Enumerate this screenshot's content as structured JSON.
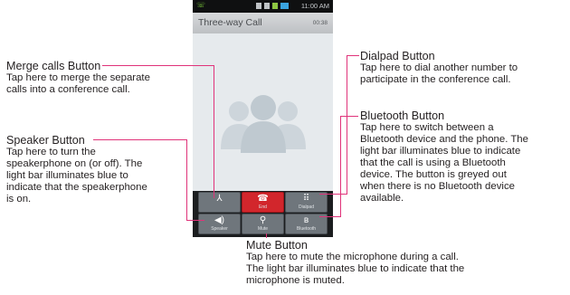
{
  "phone": {
    "status_time": "11:00 AM",
    "call_title": "Three-way Call",
    "call_timer": "00:38",
    "buttons": {
      "merge": {
        "icon": "person-merge-icon",
        "glyph": "⅄",
        "label": ""
      },
      "end": {
        "icon": "phone-hangup-icon",
        "glyph": "☎",
        "label": "End"
      },
      "dialpad": {
        "icon": "dialpad-icon",
        "glyph": "⠿",
        "label": "Dialpad"
      },
      "speaker": {
        "icon": "speaker-icon",
        "glyph": "◀)",
        "label": "Speaker"
      },
      "mute": {
        "icon": "microphone-icon",
        "glyph": "⚲",
        "label": "Mute"
      },
      "bluetooth": {
        "icon": "bluetooth-icon",
        "glyph": "ʙ",
        "label": "Bluetooth"
      }
    },
    "colors": {
      "end_red": "#d2262c",
      "button_gray": "#6f767c",
      "background": "#e6eaed",
      "leader_pink": "#e0337a"
    }
  },
  "callouts": {
    "merge": {
      "title": "Merge calls Button",
      "body": [
        "Tap here to merge the separate",
        "calls into a conference call."
      ]
    },
    "speaker": {
      "title": "Speaker Button",
      "body": [
        "Tap here to turn the",
        "speakerphone on (or off). The",
        "light bar illuminates blue to",
        "indicate that the speakerphone",
        "is on."
      ]
    },
    "dialpad": {
      "title": "Dialpad Button",
      "body": [
        "Tap here to dial another number to",
        "participate in the conference call."
      ]
    },
    "bluetooth": {
      "title": "Bluetooth Button",
      "body": [
        "Tap here to switch between a",
        "Bluetooth device and the phone. The",
        "light bar illuminates blue to indicate",
        "that the call is using a Bluetooth",
        "device. The button is greyed out",
        "when there is no Bluetooth device",
        "available."
      ]
    },
    "mute": {
      "title": "Mute Button",
      "body": [
        "Tap here to mute the microphone during a call.",
        "The light bar illuminates blue to indicate that the",
        "microphone is muted."
      ]
    }
  }
}
